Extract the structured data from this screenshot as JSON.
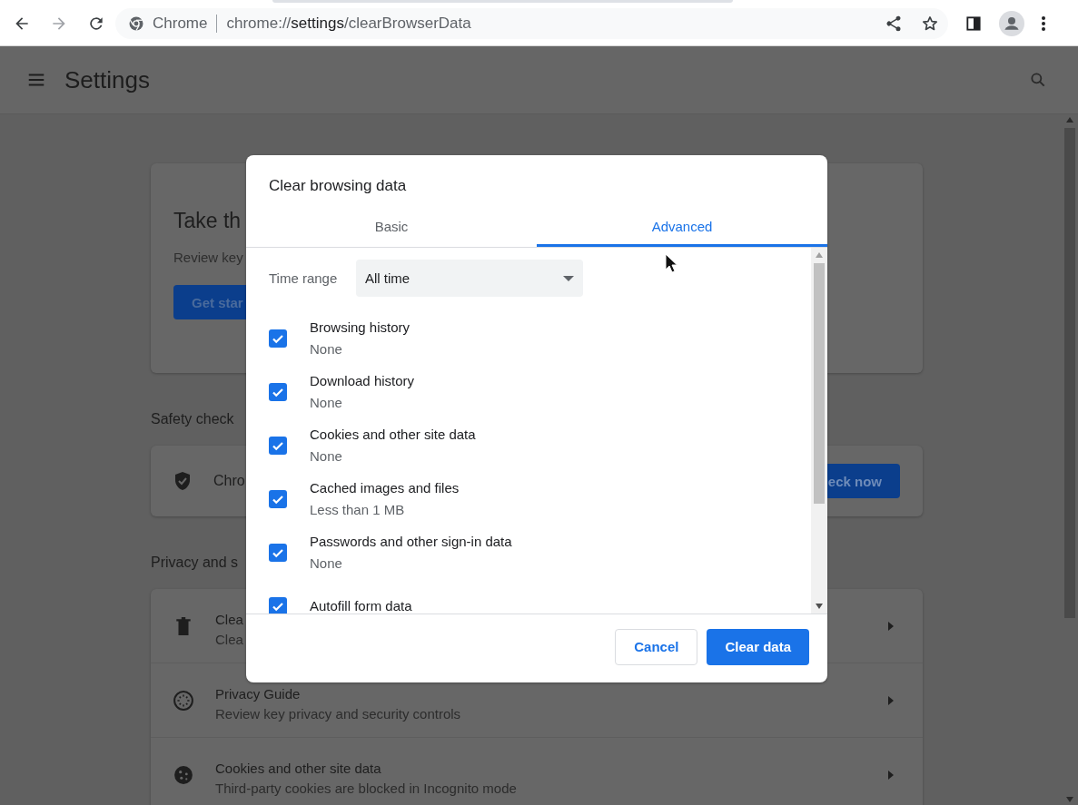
{
  "toolbar": {
    "nav": [
      {
        "kind": "back",
        "disabled": false
      },
      {
        "kind": "forward",
        "disabled": true
      },
      {
        "kind": "reload",
        "disabled": false
      }
    ],
    "omnibox": {
      "chip": "Chrome",
      "url": {
        "scheme": "chrome://",
        "host": "settings",
        "path": "/clearBrowserData"
      }
    }
  },
  "settings": {
    "title": "Settings",
    "hero": {
      "title": "Take th",
      "text": "Review key",
      "button": "Get star"
    },
    "safety": {
      "heading": "Safety check",
      "text": "Chro",
      "button": "eck now"
    },
    "privacy": {
      "heading": "Privacy and s",
      "rows": [
        {
          "kind": "trash",
          "title": "Clea",
          "subtitle": "Clea"
        },
        {
          "kind": "compass",
          "title": "Privacy Guide",
          "subtitle": "Review key privacy and security controls"
        },
        {
          "kind": "cookie",
          "title": "Cookies and other site data",
          "subtitle": "Third-party cookies are blocked in Incognito mode"
        }
      ]
    }
  },
  "dialog": {
    "title": "Clear browsing data",
    "tabs": [
      {
        "label": "Basic",
        "selected": false
      },
      {
        "label": "Advanced",
        "selected": true
      }
    ],
    "time_range": {
      "label": "Time range",
      "value": "All time"
    },
    "items": [
      {
        "label": "Browsing history",
        "detail": "None",
        "checked": true
      },
      {
        "label": "Download history",
        "detail": "None",
        "checked": true
      },
      {
        "label": "Cookies and other site data",
        "detail": "None",
        "checked": true
      },
      {
        "label": "Cached images and files",
        "detail": "Less than 1 MB",
        "checked": true
      },
      {
        "label": "Passwords and other sign-in data",
        "detail": "None",
        "checked": true
      },
      {
        "label": "Autofill form data",
        "checked": true
      }
    ],
    "buttons": [
      {
        "label": "Cancel",
        "kind": "secondary"
      },
      {
        "label": "Clear data",
        "kind": "primary"
      }
    ]
  }
}
